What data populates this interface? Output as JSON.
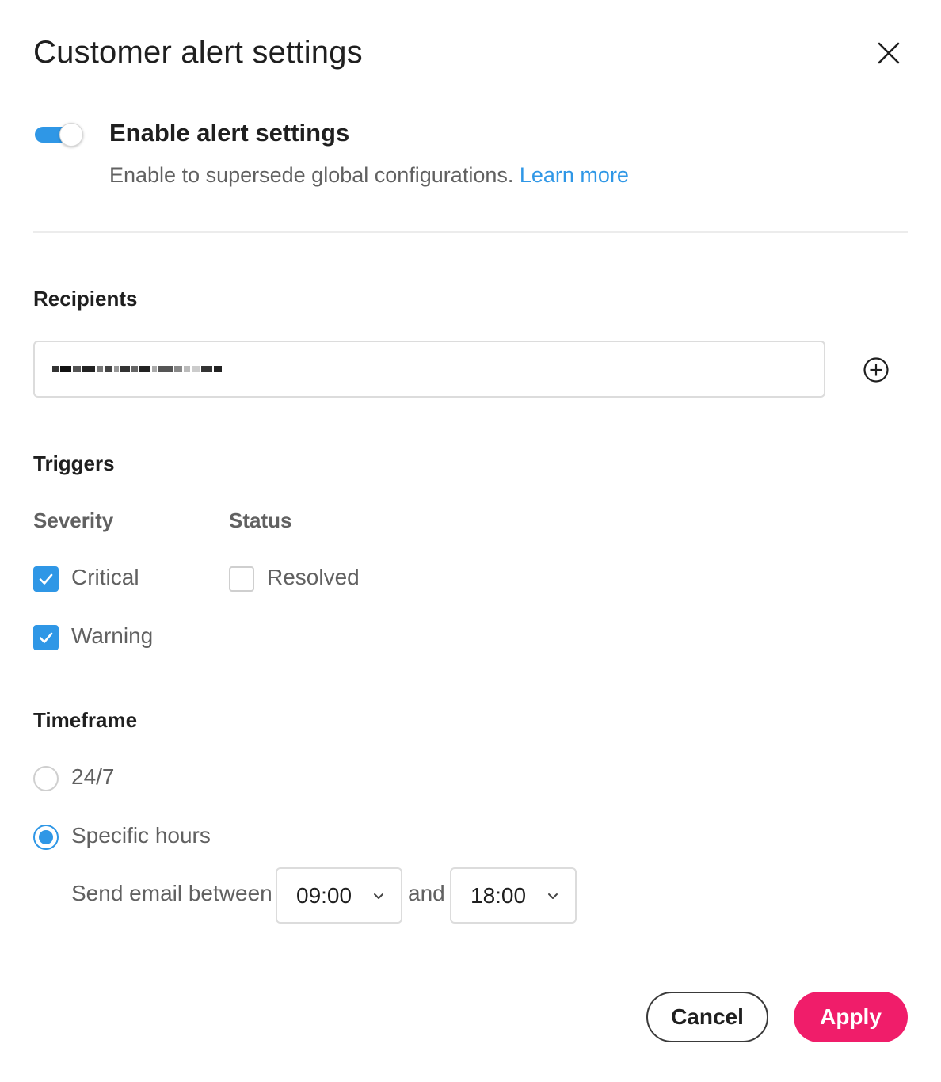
{
  "dialog": {
    "title": "Customer alert settings",
    "close_icon": "close-icon"
  },
  "enable": {
    "toggle_on": true,
    "title": "Enable alert settings",
    "description": "Enable to supersede global configurations.",
    "learn_more": "Learn more"
  },
  "recipients": {
    "heading": "Recipients",
    "value_obscured": true,
    "add_icon": "add-circle-icon"
  },
  "triggers": {
    "heading": "Triggers",
    "severity": {
      "heading": "Severity",
      "options": [
        {
          "label": "Critical",
          "checked": true
        },
        {
          "label": "Warning",
          "checked": true
        }
      ]
    },
    "status": {
      "heading": "Status",
      "options": [
        {
          "label": "Resolved",
          "checked": false
        }
      ]
    }
  },
  "timeframe": {
    "heading": "Timeframe",
    "options": [
      {
        "label": "24/7",
        "selected": false
      },
      {
        "label": "Specific hours",
        "selected": true
      }
    ],
    "send_between_label": "Send email between",
    "and_label": "and",
    "start_time": "09:00",
    "end_time": "18:00"
  },
  "actions": {
    "cancel": "Cancel",
    "apply": "Apply"
  },
  "colors": {
    "accent": "#2f97e6",
    "primary_button": "#f01d6a"
  }
}
